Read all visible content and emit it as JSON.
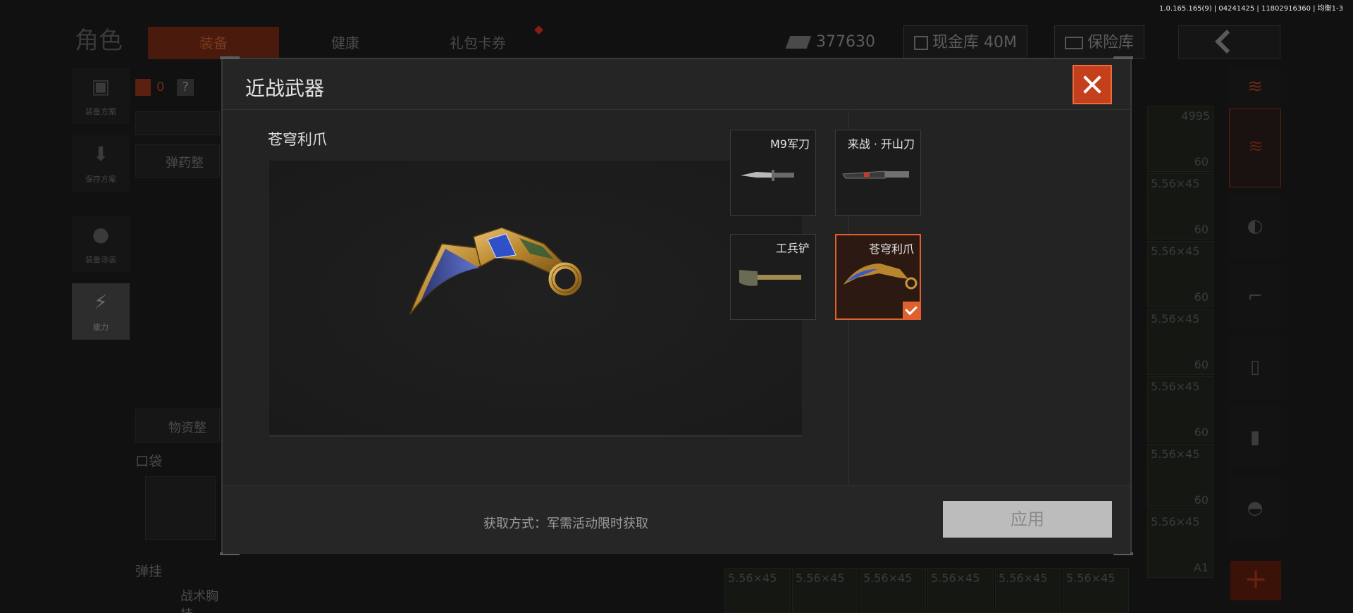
{
  "version": "1.0.165.165(9) | 04241425 | 11802916360 | 均衡1-3",
  "header": {
    "title": "角色",
    "tabs": [
      {
        "label": "装备",
        "active": true
      },
      {
        "label": "健康",
        "active": false
      },
      {
        "label": "礼包卡券",
        "active": false,
        "badge": true
      }
    ],
    "currency": "377630",
    "cash_vault": "现金库 40M",
    "safe": "保险库"
  },
  "left_nav": [
    {
      "label": "装备方案",
      "icon": "vest-icon"
    },
    {
      "label": "保存方案",
      "icon": "download-icon"
    },
    {
      "label": "装备涂装",
      "icon": "helmet-icon"
    },
    {
      "label": "能力",
      "icon": "energy-icon"
    }
  ],
  "left_panel": {
    "count": "0",
    "ammo_sort": "弹药整",
    "supplies_sort": "物资整",
    "pocket": "口袋",
    "rig": "弹挂",
    "tactical_rig": "战术胸挂"
  },
  "grid": {
    "caliber": "5.56×45",
    "variant": "A1",
    "count": "60",
    "partial_top": "4995"
  },
  "modal": {
    "title": "近战武器",
    "preview_name": "苍穹利爪",
    "items": [
      {
        "name": "M9军刀",
        "selected": false,
        "icon": "bayonet-icon"
      },
      {
        "name": "来战 · 开山刀",
        "selected": false,
        "icon": "machete-icon"
      },
      {
        "name": "工兵铲",
        "selected": false,
        "icon": "shovel-icon"
      },
      {
        "name": "苍穹利爪",
        "selected": true,
        "icon": "karambit-icon"
      }
    ],
    "source": "获取方式：军需活动限时获取",
    "apply_label": "应用"
  },
  "colors": {
    "accent": "#e06030",
    "close_bg": "#c4401c",
    "apply_bg": "#bcbcbc"
  }
}
